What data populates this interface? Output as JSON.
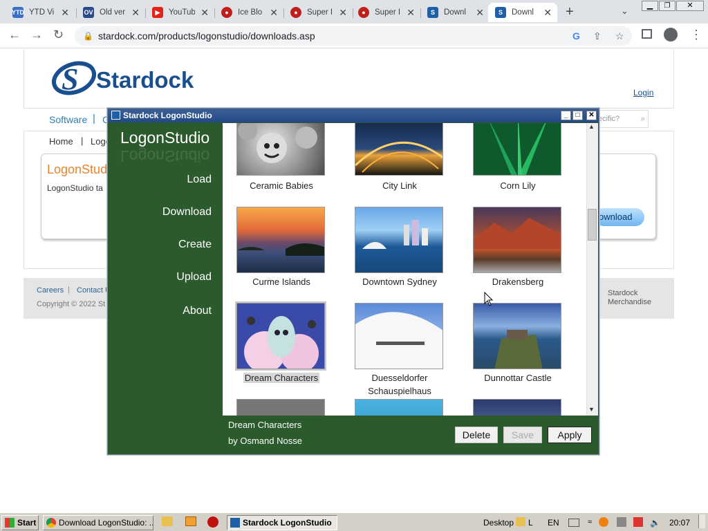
{
  "browser": {
    "tabs": [
      {
        "title": "YTD Vi",
        "favicon": "YTD"
      },
      {
        "title": "Old ver",
        "favicon": "OV"
      },
      {
        "title": "YouTub",
        "favicon": "▶"
      },
      {
        "title": "Ice Blo",
        "favicon": "●"
      },
      {
        "title": "Super I",
        "favicon": "●"
      },
      {
        "title": "Super I",
        "favicon": "●"
      },
      {
        "title": "Downl",
        "favicon": "S"
      },
      {
        "title": "Downl",
        "favicon": "S"
      }
    ],
    "url": "stardock.com/products/logonstudio/downloads.asp"
  },
  "site": {
    "logo_text": "Stardock",
    "login": "Login",
    "nav_software": "Software",
    "nav_partial": "C",
    "search_placeholder": "ecific?",
    "breadcrumb_home": "Home",
    "breadcrumb_sep": "|",
    "breadcrumb_partial": "Logo",
    "panel_title": "LogonStudi",
    "panel_text": "LogonStudio ta",
    "download_btn": "ownload",
    "footer_careers": "Careers",
    "footer_contact": "Contact U",
    "copyright": "Copyright © 2022 St",
    "merch_1": "Stardock",
    "merch_2": "Merchandise"
  },
  "dialog": {
    "title": "Stardock LogonStudio",
    "brand": "LogonStudio",
    "nav": [
      "Load",
      "Download",
      "Create",
      "Upload",
      "About"
    ],
    "items": [
      {
        "name": "Ceramic Babies"
      },
      {
        "name": "City Link"
      },
      {
        "name": "Corn Lily"
      },
      {
        "name": "Curme Islands"
      },
      {
        "name": "Downtown Sydney"
      },
      {
        "name": "Drakensberg"
      },
      {
        "name": "Dream Characters",
        "selected": true
      },
      {
        "name": "Duesseldorfer Schauspielhaus"
      },
      {
        "name": "Dunnottar Castle"
      }
    ],
    "selected_name": "Dream Characters",
    "selected_author": "by Osmand Nosse",
    "buttons": {
      "delete": "Delete",
      "save": "Save",
      "apply": "Apply"
    }
  },
  "taskbar": {
    "start": "Start",
    "task_chrome": "Download LogonStudio: ...",
    "task_logon": "Stardock LogonStudio",
    "desktop": "Desktop",
    "lang": "EN",
    "clock": "20:07"
  }
}
